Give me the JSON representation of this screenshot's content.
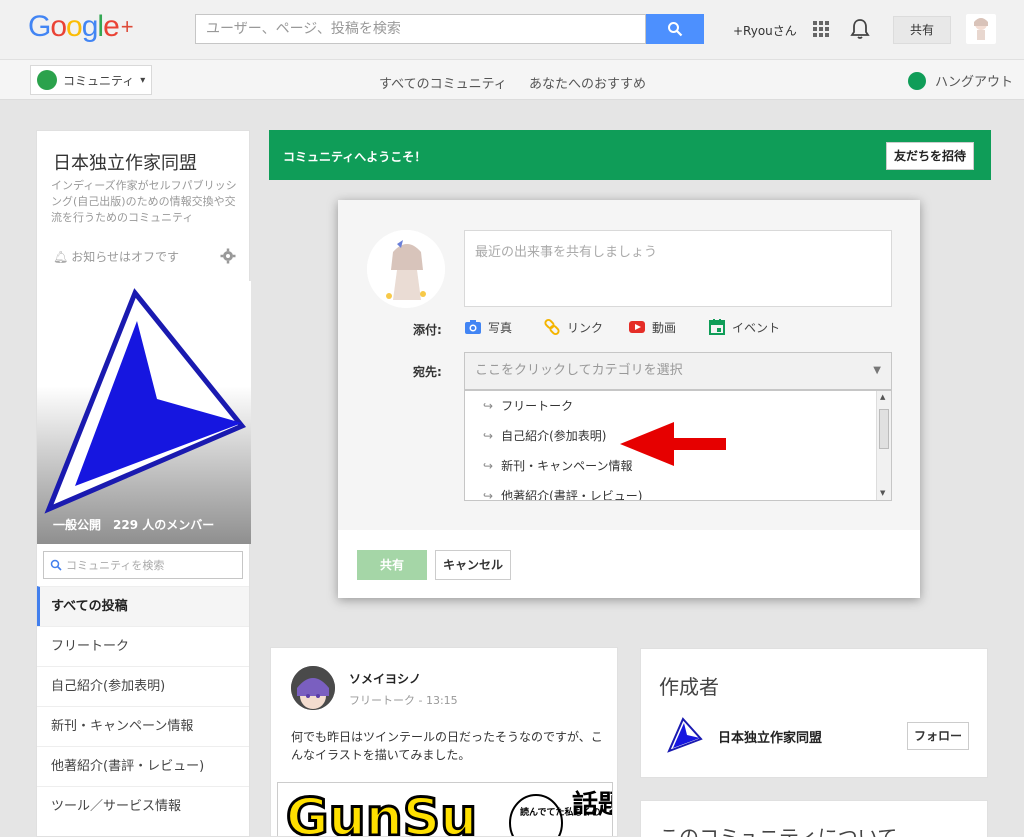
{
  "topbar": {
    "logo_letters": [
      "G",
      "o",
      "o",
      "g",
      "l",
      "e"
    ],
    "logo_colors": [
      "#4285f4",
      "#ea4335",
      "#fbbc05",
      "#4285f4",
      "#34a853",
      "#ea4335"
    ],
    "logo_plus": "+",
    "search_placeholder": "ユーザー、ページ、投稿を検索",
    "user_label": "+Ryouさん",
    "share_label": "共有"
  },
  "subbar": {
    "community_dropdown": "コミュニティ",
    "nav_all": "すべてのコミュニティ",
    "nav_recommended": "あなたへのおすすめ",
    "hangout": "ハングアウト"
  },
  "community": {
    "name": "日本独立作家同盟",
    "description": "インディーズ作家がセルフパブリッシング(自己出版)のための情報交換や交流を行うためのコミュニティ",
    "notice": "お知らせはオフです",
    "members_label": "一般公開　229 人のメンバー",
    "search_placeholder": "コミュニティを検索",
    "nav": [
      {
        "label": "すべての投稿",
        "active": true
      },
      {
        "label": "フリートーク",
        "active": false
      },
      {
        "label": "自己紹介(参加表明)",
        "active": false
      },
      {
        "label": "新刊・キャンペーン情報",
        "active": false
      },
      {
        "label": "他著紹介(書評・レビュー)",
        "active": false
      },
      {
        "label": "ツール／サービス情報",
        "active": false
      }
    ]
  },
  "welcome": {
    "text": "コミュニティへようこそ！",
    "invite_button": "友だちを招待"
  },
  "sharebox": {
    "placeholder": "最近の出来事を共有しましょう",
    "attach_label": "添付:",
    "attach_items": [
      "写真",
      "リンク",
      "動画",
      "イベント"
    ],
    "to_label": "宛先:",
    "select_placeholder": "ここをクリックしてカテゴリを選択",
    "categories": [
      "フリートーク",
      "自己紹介(参加表明)",
      "新刊・キャンペーン情報",
      "他著紹介(書評・レビュー)"
    ],
    "share_button": "共有",
    "cancel_button": "キャンセル"
  },
  "post": {
    "author": "ソメイヨシノ",
    "meta": "フリートーク - 13:15",
    "text": "何でも昨日はツインテールの日だったそうなのですが、こんなイラストを描いてみました。",
    "image_caption": "GunSu",
    "image_side_text": "話題",
    "image_bubble_text": "読んでてた私もくの"
  },
  "creator": {
    "title": "作成者",
    "name": "日本独立作家同盟",
    "follow_button": "フォロー"
  },
  "about": {
    "title": "このコミュニティについて"
  }
}
